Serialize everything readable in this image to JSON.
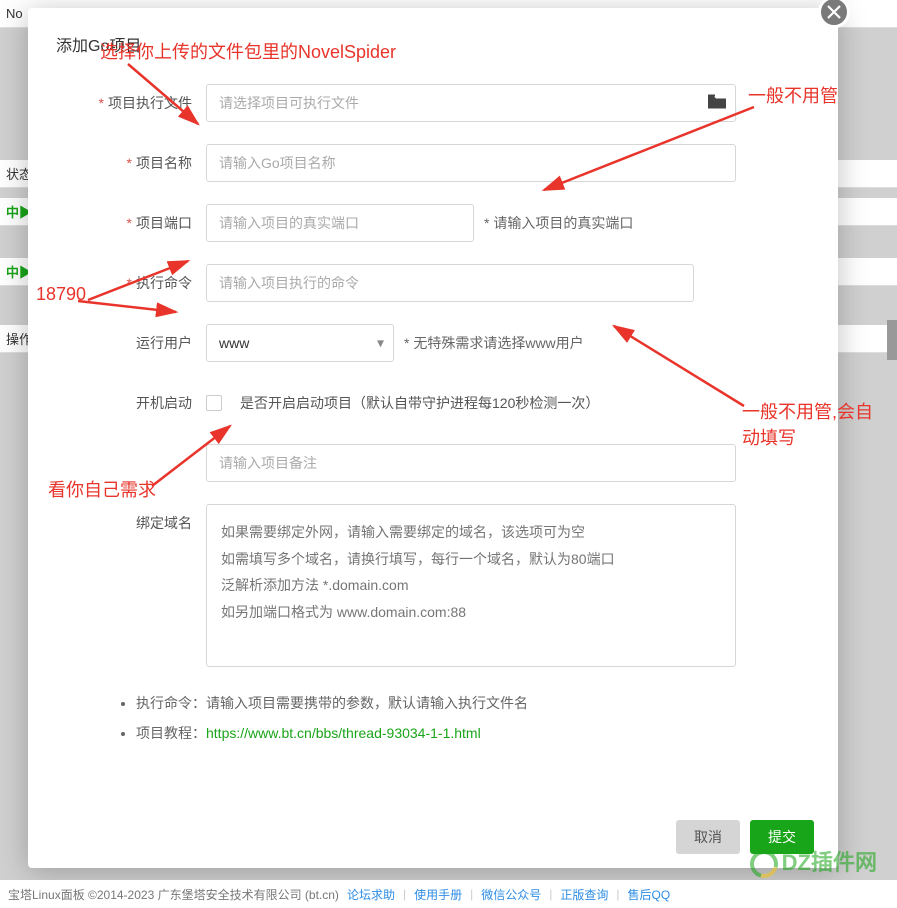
{
  "modal": {
    "title": "添加Go项目",
    "fields": {
      "exec_file": {
        "label": "项目执行文件",
        "placeholder": "请选择项目可执行文件"
      },
      "name": {
        "label": "项目名称",
        "placeholder": "请输入Go项目名称"
      },
      "port": {
        "label": "项目端口",
        "placeholder": "请输入项目的真实端口",
        "hint": "* 请输入项目的真实端口"
      },
      "cmd": {
        "label": "执行命令",
        "placeholder": "请输入项目执行的命令"
      },
      "user": {
        "label": "运行用户",
        "value": "www",
        "hint": "* 无特殊需求请选择www用户"
      },
      "autostart": {
        "label": "开机启动",
        "text": "是否开启启动项目（默认自带守护进程每120秒检测一次）"
      },
      "remark": {
        "placeholder": "请输入项目备注"
      },
      "domain": {
        "label": "绑定域名",
        "placeholder": "如果需要绑定外网，请输入需要绑定的域名，该选项可为空\n如需填写多个域名，请换行填写，每行一个域名，默认为80端口\n泛解析添加方法 *.domain.com\n如另加端口格式为 www.domain.com:88"
      }
    },
    "notes": {
      "n1_label": "执行命令：",
      "n1_text": "请输入项目需要携带的参数，默认请输入执行文件名",
      "n2_label": "项目教程：",
      "n2_link": "https://www.bt.cn/bbs/thread-93034-1-1.html"
    },
    "buttons": {
      "cancel": "取消",
      "submit": "提交"
    }
  },
  "annotations": {
    "a1": "选择你上传的文件包里的NovelSpider",
    "a2": "一般不用管",
    "a3": "18790",
    "a4": "一般不用管,会自动填写",
    "a5": "看你自己需求"
  },
  "background": {
    "tab": "No",
    "status_label": "状态",
    "running1": "中▶",
    "running2": "中▶",
    "ops": "操作"
  },
  "footer_bar": {
    "copyright": "宝塔Linux面板 ©2014-2023 广东堡塔安全技术有限公司 (bt.cn)",
    "l1": "论坛求助",
    "l2": "使用手册",
    "l3": "微信公众号",
    "l4": "正版查询",
    "l5": "售后QQ"
  },
  "watermark": "DZ插件网"
}
